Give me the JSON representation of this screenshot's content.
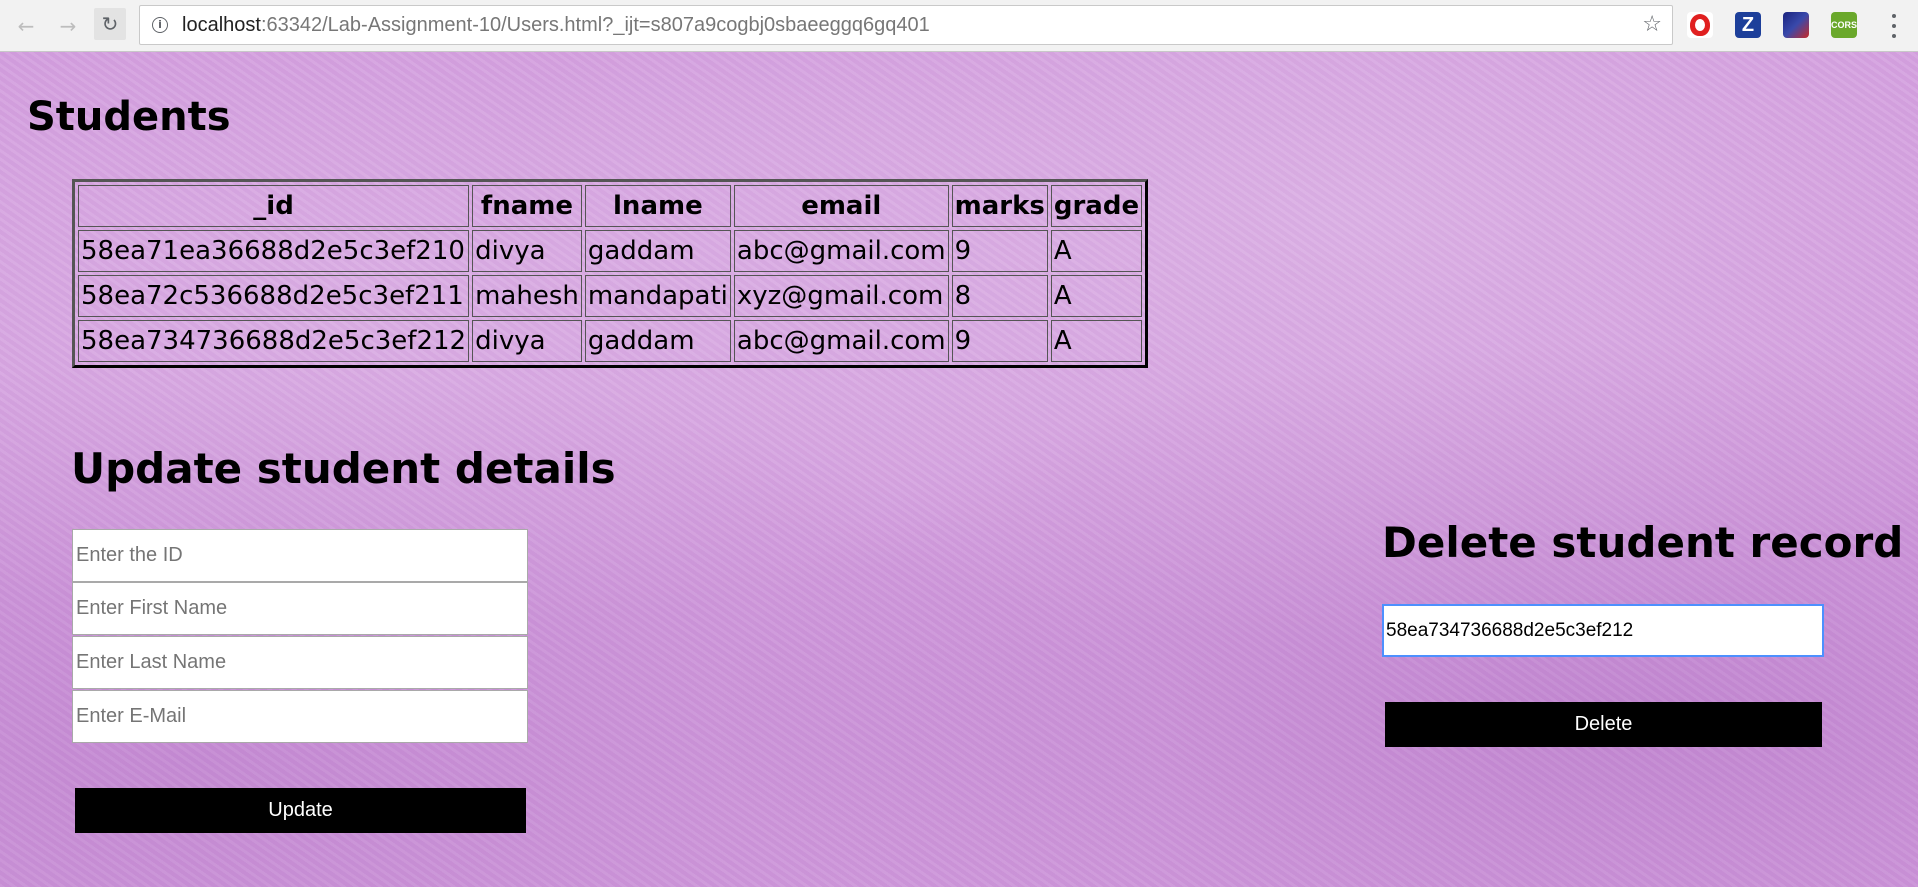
{
  "browser": {
    "url_host": "localhost",
    "url_rest": ":63342/Lab-Assignment-10/Users.html?_ijt=s807a9cogbj0sbaeeggq6gq401",
    "extensions": [
      "adblock-icon",
      "zotero-icon",
      "extension-icon",
      "cors-icon"
    ],
    "ext_z_label": "Z",
    "ext_cors_label": "CORS"
  },
  "page": {
    "title": "Students",
    "table": {
      "headers": [
        "_id",
        "fname",
        "lname",
        "email",
        "marks",
        "grade"
      ],
      "rows": [
        [
          "58ea71ea36688d2e5c3ef210",
          "divya",
          "gaddam",
          "abc@gmail.com",
          "9",
          "A"
        ],
        [
          "58ea72c536688d2e5c3ef211",
          "mahesh",
          "mandapati",
          "xyz@gmail.com",
          "8",
          "A"
        ],
        [
          "58ea734736688d2e5c3ef212",
          "divya",
          "gaddam",
          "abc@gmail.com",
          "9",
          "A"
        ]
      ]
    },
    "update": {
      "title": "Update student details",
      "id_placeholder": "Enter the ID",
      "fname_placeholder": "Enter First Name",
      "lname_placeholder": "Enter Last Name",
      "email_placeholder": "Enter E-Mail",
      "button_label": "Update"
    },
    "delete": {
      "title": "Delete student record",
      "input_value": "58ea734736688d2e5c3ef212",
      "button_label": "Delete"
    }
  }
}
